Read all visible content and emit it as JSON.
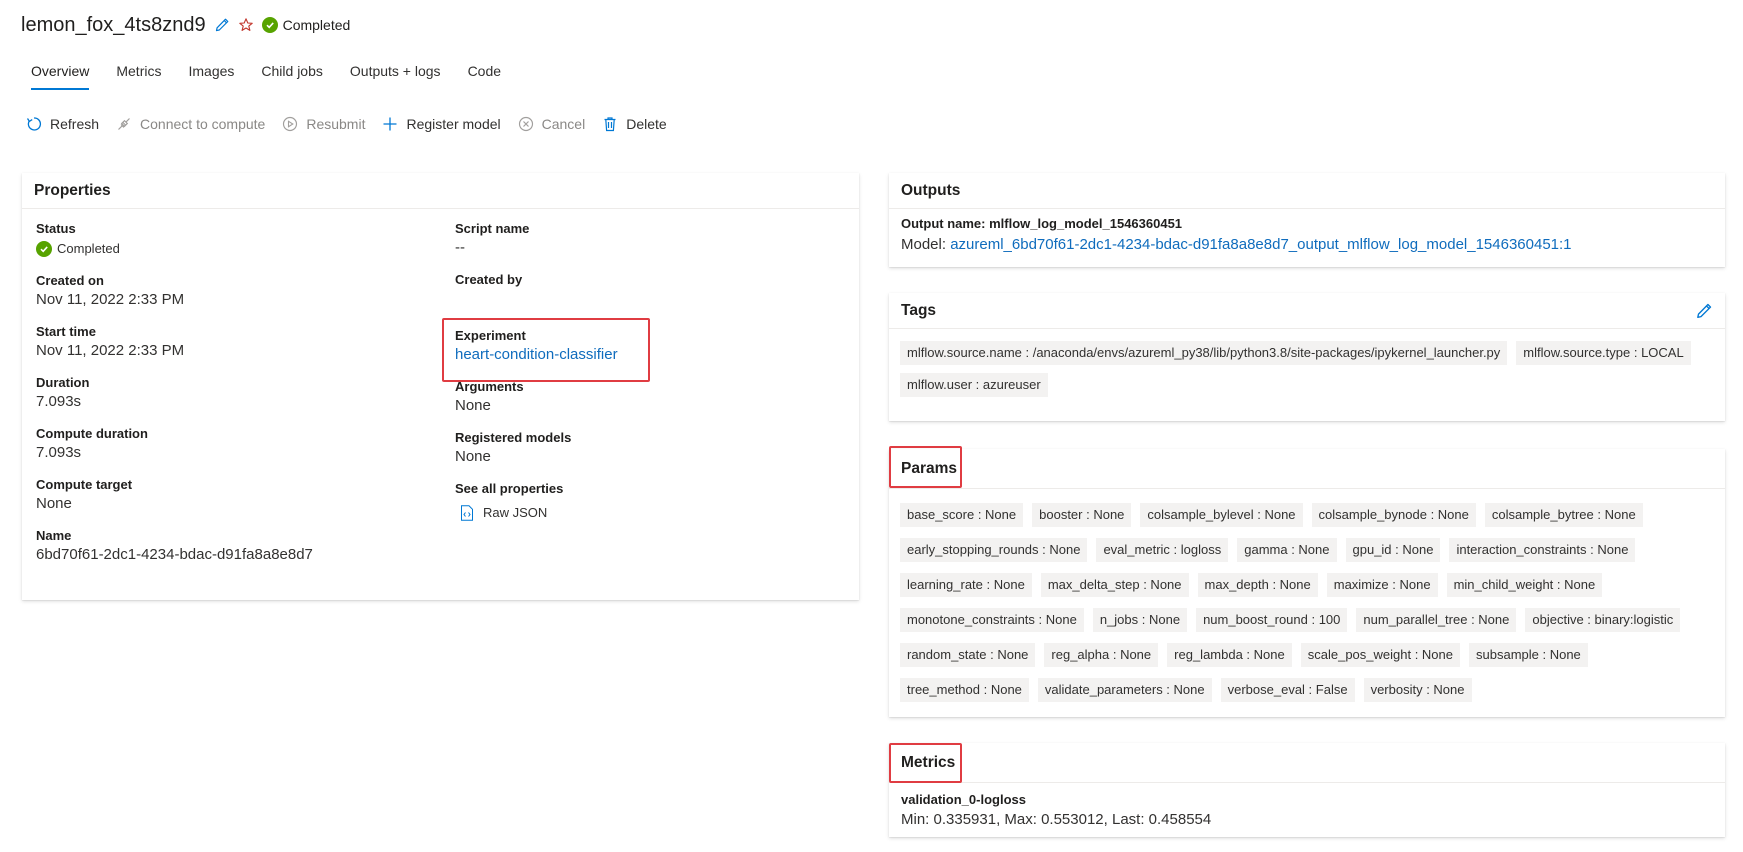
{
  "header": {
    "title": "lemon_fox_4ts8znd9",
    "status": "Completed",
    "icons": [
      "edit-icon",
      "star-icon",
      "status-check-icon"
    ],
    "status_color": "#57a300"
  },
  "tabs": [
    {
      "label": "Overview"
    },
    {
      "label": "Metrics"
    },
    {
      "label": "Images"
    },
    {
      "label": "Child jobs"
    },
    {
      "label": "Outputs + logs"
    },
    {
      "label": "Code"
    }
  ],
  "toolbar": {
    "refresh": "Refresh",
    "connect": "Connect to compute",
    "resubmit": "Resubmit",
    "register": "Register model",
    "cancel": "Cancel",
    "delete": "Delete"
  },
  "properties": {
    "title": "Properties",
    "left": [
      {
        "label": "Status",
        "value": "Completed"
      },
      {
        "label": "Created on",
        "value": "Nov 11, 2022 2:33 PM"
      },
      {
        "label": "Start time",
        "value": "Nov 11, 2022 2:33 PM"
      },
      {
        "label": "Duration",
        "value": "7.093s"
      },
      {
        "label": "Compute duration",
        "value": "7.093s"
      },
      {
        "label": "Compute target",
        "value": "None"
      },
      {
        "label": "Name",
        "value": "6bd70f61-2dc1-4234-bdac-d91fa8a8e8d7"
      }
    ],
    "right": {
      "script_label": "Script name",
      "script_value": "--",
      "created_by_label": "Created by",
      "created_by_value": "",
      "experiment_label": "Experiment",
      "experiment_value": "heart-condition-classifier",
      "arguments_label": "Arguments",
      "arguments_value": "None",
      "registered_label": "Registered models",
      "registered_value": "None",
      "see_all_label": "See all properties",
      "raw_json": "Raw JSON"
    }
  },
  "outputs": {
    "title": "Outputs",
    "output_name": "Output name: mlflow_log_model_1546360451",
    "model_prefix": "Model: ",
    "model_link": "azureml_6bd70f61-2dc1-4234-bdac-d91fa8a8e8d7_output_mlflow_log_model_1546360451:1"
  },
  "tags": {
    "title": "Tags",
    "items": [
      "mlflow.source.name : /anaconda/envs/azureml_py38/lib/python3.8/site-packages/ipykernel_launcher.py",
      "mlflow.source.type : LOCAL",
      "mlflow.user : azureuser"
    ]
  },
  "params": {
    "title": "Params",
    "items": [
      "base_score : None",
      "booster : None",
      "colsample_bylevel : None",
      "colsample_bynode : None",
      "colsample_bytree : None",
      "early_stopping_rounds : None",
      "eval_metric : logloss",
      "gamma : None",
      "gpu_id : None",
      "interaction_constraints : None",
      "learning_rate : None",
      "max_delta_step : None",
      "max_depth : None",
      "maximize : None",
      "min_child_weight : None",
      "monotone_constraints : None",
      "n_jobs : None",
      "num_boost_round : 100",
      "num_parallel_tree : None",
      "objective : binary:logistic",
      "random_state : None",
      "reg_alpha : None",
      "reg_lambda : None",
      "scale_pos_weight : None",
      "subsample : None",
      "tree_method : None",
      "validate_parameters : None",
      "verbose_eval : False",
      "verbosity : None"
    ]
  },
  "metrics": {
    "title": "Metrics",
    "name": "validation_0-logloss",
    "summary": "Min: 0.335931, Max: 0.553012, Last: 0.458554"
  },
  "colors": {
    "accent": "#0078d4",
    "link": "#0f6cbd",
    "highlight": "#e03c42",
    "success": "#57a300"
  }
}
